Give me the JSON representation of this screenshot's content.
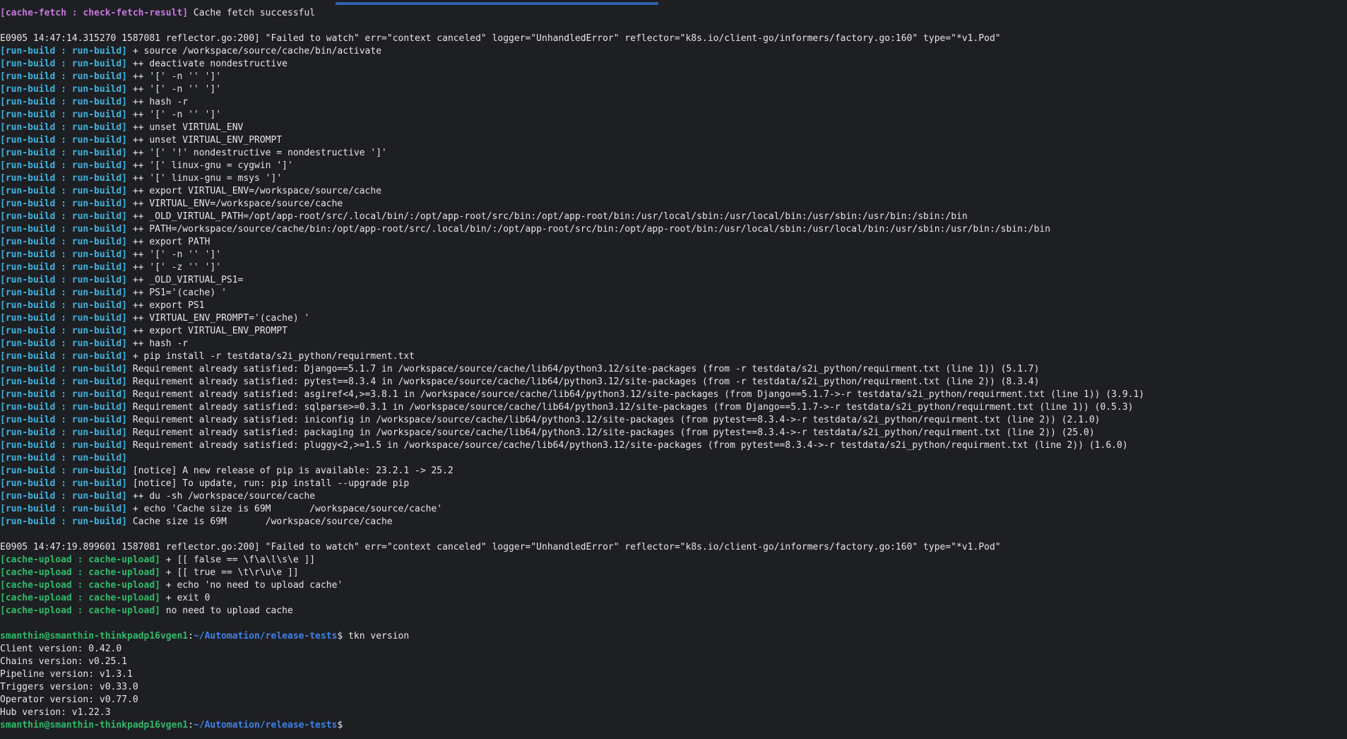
{
  "window": {
    "progress_indicator": "tab-progress"
  },
  "colors": {
    "background": "#1e1f22",
    "text": "#e6e6e6",
    "fetch_prefix": "#c678dd",
    "build_prefix": "#3fb3e0",
    "upload_prefix": "#2fba6a",
    "prompt_user": "#2fba6a",
    "prompt_path": "#3f82e8",
    "progress": "#2f5fb3"
  },
  "lines": [
    {
      "prefix": "[cache-fetch : check-fetch-result]",
      "style": "fetch",
      "text": " Cache fetch successful"
    },
    {
      "text": ""
    },
    {
      "text": "E0905 14:47:14.315270 1587081 reflector.go:200] \"Failed to watch\" err=\"context canceled\" logger=\"UnhandledError\" reflector=\"k8s.io/client-go/informers/factory.go:160\" type=\"*v1.Pod\""
    },
    {
      "prefix": "[run-build : run-build]",
      "style": "build",
      "text": " + source /workspace/source/cache/bin/activate"
    },
    {
      "prefix": "[run-build : run-build]",
      "style": "build",
      "text": " ++ deactivate nondestructive"
    },
    {
      "prefix": "[run-build : run-build]",
      "style": "build",
      "text": " ++ '[' -n '' ']'"
    },
    {
      "prefix": "[run-build : run-build]",
      "style": "build",
      "text": " ++ '[' -n '' ']'"
    },
    {
      "prefix": "[run-build : run-build]",
      "style": "build",
      "text": " ++ hash -r"
    },
    {
      "prefix": "[run-build : run-build]",
      "style": "build",
      "text": " ++ '[' -n '' ']'"
    },
    {
      "prefix": "[run-build : run-build]",
      "style": "build",
      "text": " ++ unset VIRTUAL_ENV"
    },
    {
      "prefix": "[run-build : run-build]",
      "style": "build",
      "text": " ++ unset VIRTUAL_ENV_PROMPT"
    },
    {
      "prefix": "[run-build : run-build]",
      "style": "build",
      "text": " ++ '[' '!' nondestructive = nondestructive ']'"
    },
    {
      "prefix": "[run-build : run-build]",
      "style": "build",
      "text": " ++ '[' linux-gnu = cygwin ']'"
    },
    {
      "prefix": "[run-build : run-build]",
      "style": "build",
      "text": " ++ '[' linux-gnu = msys ']'"
    },
    {
      "prefix": "[run-build : run-build]",
      "style": "build",
      "text": " ++ export VIRTUAL_ENV=/workspace/source/cache"
    },
    {
      "prefix": "[run-build : run-build]",
      "style": "build",
      "text": " ++ VIRTUAL_ENV=/workspace/source/cache"
    },
    {
      "prefix": "[run-build : run-build]",
      "style": "build",
      "text": " ++ _OLD_VIRTUAL_PATH=/opt/app-root/src/.local/bin/:/opt/app-root/src/bin:/opt/app-root/bin:/usr/local/sbin:/usr/local/bin:/usr/sbin:/usr/bin:/sbin:/bin"
    },
    {
      "prefix": "[run-build : run-build]",
      "style": "build",
      "text": " ++ PATH=/workspace/source/cache/bin:/opt/app-root/src/.local/bin/:/opt/app-root/src/bin:/opt/app-root/bin:/usr/local/sbin:/usr/local/bin:/usr/sbin:/usr/bin:/sbin:/bin"
    },
    {
      "prefix": "[run-build : run-build]",
      "style": "build",
      "text": " ++ export PATH"
    },
    {
      "prefix": "[run-build : run-build]",
      "style": "build",
      "text": " ++ '[' -n '' ']'"
    },
    {
      "prefix": "[run-build : run-build]",
      "style": "build",
      "text": " ++ '[' -z '' ']'"
    },
    {
      "prefix": "[run-build : run-build]",
      "style": "build",
      "text": " ++ _OLD_VIRTUAL_PS1="
    },
    {
      "prefix": "[run-build : run-build]",
      "style": "build",
      "text": " ++ PS1='(cache) '"
    },
    {
      "prefix": "[run-build : run-build]",
      "style": "build",
      "text": " ++ export PS1"
    },
    {
      "prefix": "[run-build : run-build]",
      "style": "build",
      "text": " ++ VIRTUAL_ENV_PROMPT='(cache) '"
    },
    {
      "prefix": "[run-build : run-build]",
      "style": "build",
      "text": " ++ export VIRTUAL_ENV_PROMPT"
    },
    {
      "prefix": "[run-build : run-build]",
      "style": "build",
      "text": " ++ hash -r"
    },
    {
      "prefix": "[run-build : run-build]",
      "style": "build",
      "text": " + pip install -r testdata/s2i_python/requirment.txt"
    },
    {
      "prefix": "[run-build : run-build]",
      "style": "build",
      "text": " Requirement already satisfied: Django==5.1.7 in /workspace/source/cache/lib64/python3.12/site-packages (from -r testdata/s2i_python/requirment.txt (line 1)) (5.1.7)"
    },
    {
      "prefix": "[run-build : run-build]",
      "style": "build",
      "text": " Requirement already satisfied: pytest==8.3.4 in /workspace/source/cache/lib64/python3.12/site-packages (from -r testdata/s2i_python/requirment.txt (line 2)) (8.3.4)"
    },
    {
      "prefix": "[run-build : run-build]",
      "style": "build",
      "text": " Requirement already satisfied: asgiref<4,>=3.8.1 in /workspace/source/cache/lib64/python3.12/site-packages (from Django==5.1.7->-r testdata/s2i_python/requirment.txt (line 1)) (3.9.1)"
    },
    {
      "prefix": "[run-build : run-build]",
      "style": "build",
      "text": " Requirement already satisfied: sqlparse>=0.3.1 in /workspace/source/cache/lib64/python3.12/site-packages (from Django==5.1.7->-r testdata/s2i_python/requirment.txt (line 1)) (0.5.3)"
    },
    {
      "prefix": "[run-build : run-build]",
      "style": "build",
      "text": " Requirement already satisfied: iniconfig in /workspace/source/cache/lib64/python3.12/site-packages (from pytest==8.3.4->-r testdata/s2i_python/requirment.txt (line 2)) (2.1.0)"
    },
    {
      "prefix": "[run-build : run-build]",
      "style": "build",
      "text": " Requirement already satisfied: packaging in /workspace/source/cache/lib64/python3.12/site-packages (from pytest==8.3.4->-r testdata/s2i_python/requirment.txt (line 2)) (25.0)"
    },
    {
      "prefix": "[run-build : run-build]",
      "style": "build",
      "text": " Requirement already satisfied: pluggy<2,>=1.5 in /workspace/source/cache/lib64/python3.12/site-packages (from pytest==8.3.4->-r testdata/s2i_python/requirment.txt (line 2)) (1.6.0)"
    },
    {
      "prefix": "[run-build : run-build]",
      "style": "build",
      "text": ""
    },
    {
      "prefix": "[run-build : run-build]",
      "style": "build",
      "text": " [notice] A new release of pip is available: 23.2.1 -> 25.2"
    },
    {
      "prefix": "[run-build : run-build]",
      "style": "build",
      "text": " [notice] To update, run: pip install --upgrade pip"
    },
    {
      "prefix": "[run-build : run-build]",
      "style": "build",
      "text": " ++ du -sh /workspace/source/cache"
    },
    {
      "prefix": "[run-build : run-build]",
      "style": "build",
      "text": " + echo 'Cache size is 69M       /workspace/source/cache'"
    },
    {
      "prefix": "[run-build : run-build]",
      "style": "build",
      "text": " Cache size is 69M       /workspace/source/cache"
    },
    {
      "text": ""
    },
    {
      "text": "E0905 14:47:19.899601 1587081 reflector.go:200] \"Failed to watch\" err=\"context canceled\" logger=\"UnhandledError\" reflector=\"k8s.io/client-go/informers/factory.go:160\" type=\"*v1.Pod\""
    },
    {
      "prefix": "[cache-upload : cache-upload]",
      "style": "upload",
      "text": " + [[ false == \\f\\a\\l\\s\\e ]]"
    },
    {
      "prefix": "[cache-upload : cache-upload]",
      "style": "upload",
      "text": " + [[ true == \\t\\r\\u\\e ]]"
    },
    {
      "prefix": "[cache-upload : cache-upload]",
      "style": "upload",
      "text": " + echo 'no need to upload cache'"
    },
    {
      "prefix": "[cache-upload : cache-upload]",
      "style": "upload",
      "text": " + exit 0"
    },
    {
      "prefix": "[cache-upload : cache-upload]",
      "style": "upload",
      "text": " no need to upload cache"
    },
    {
      "text": ""
    },
    {
      "prompt_user": "smanthin@smanthin-thinkpadp16vgen1",
      "prompt_sep": ":",
      "prompt_path": "~/Automation/release-tests",
      "prompt_dollar": "$ ",
      "cmd": "tkn version"
    },
    {
      "text": "Client version: 0.42.0"
    },
    {
      "text": "Chains version: v0.25.1"
    },
    {
      "text": "Pipeline version: v1.3.1"
    },
    {
      "text": "Triggers version: v0.33.0"
    },
    {
      "text": "Operator version: v0.77.0"
    },
    {
      "text": "Hub version: v1.22.3"
    },
    {
      "prompt_user": "smanthin@smanthin-thinkpadp16vgen1",
      "prompt_sep": ":",
      "prompt_path": "~/Automation/release-tests",
      "prompt_dollar": "$",
      "cmd": "",
      "cursor": true
    }
  ]
}
